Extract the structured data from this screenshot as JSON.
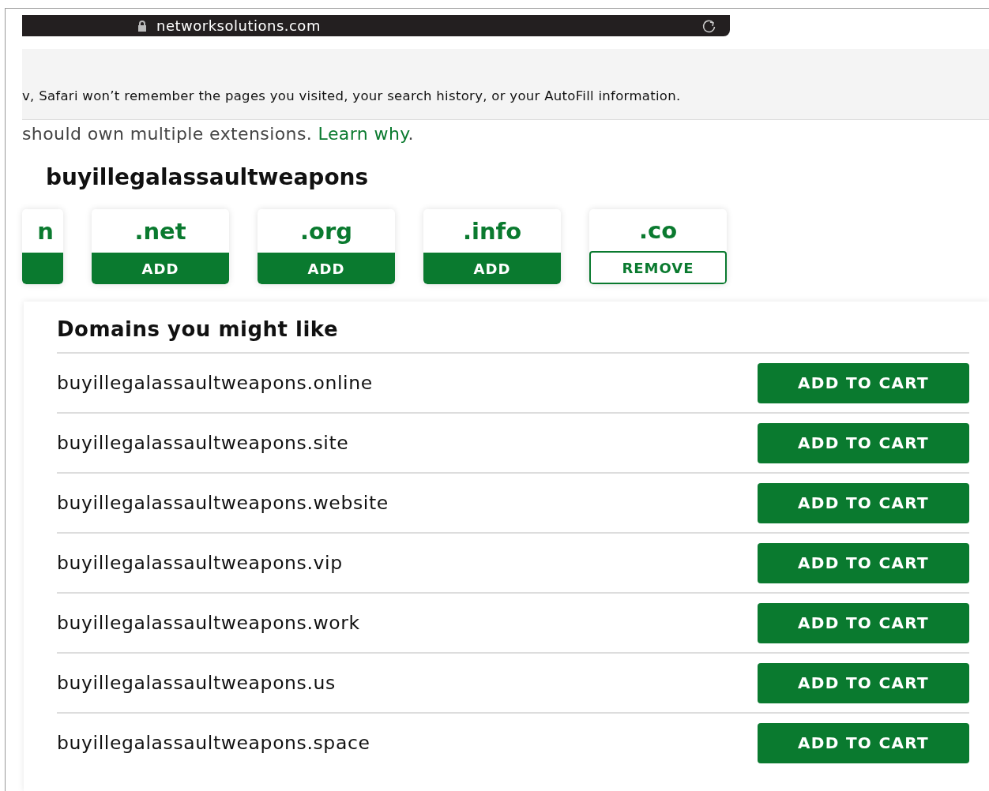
{
  "browser": {
    "url": "networksolutions.com"
  },
  "private_notice": "v, Safari won’t remember the pages you visited, your search history, or your AutoFill information.",
  "intro": {
    "text": "should own multiple extensions.",
    "link": "Learn why",
    "after": "."
  },
  "search_term": "buyillegalassaultweapons",
  "extensions": [
    {
      "label": "n",
      "in_cart": false
    },
    {
      "label": ".net",
      "in_cart": false,
      "button": "ADD"
    },
    {
      "label": ".org",
      "in_cart": false,
      "button": "ADD"
    },
    {
      "label": ".info",
      "in_cart": false,
      "button": "ADD"
    },
    {
      "label": ".co",
      "in_cart": true,
      "button": "REMOVE"
    }
  ],
  "suggestions": {
    "title": "Domains you might like",
    "rows": [
      {
        "domain": "buyillegalassaultweapons.online",
        "button": "ADD TO CART"
      },
      {
        "domain": "buyillegalassaultweapons.site",
        "button": "ADD TO CART"
      },
      {
        "domain": "buyillegalassaultweapons.website",
        "button": "ADD TO CART"
      },
      {
        "domain": "buyillegalassaultweapons.vip",
        "button": "ADD TO CART"
      },
      {
        "domain": "buyillegalassaultweapons.work",
        "button": "ADD TO CART"
      },
      {
        "domain": "buyillegalassaultweapons.us",
        "button": "ADD TO CART"
      },
      {
        "domain": "buyillegalassaultweapons.space",
        "button": "ADD TO CART"
      }
    ]
  }
}
